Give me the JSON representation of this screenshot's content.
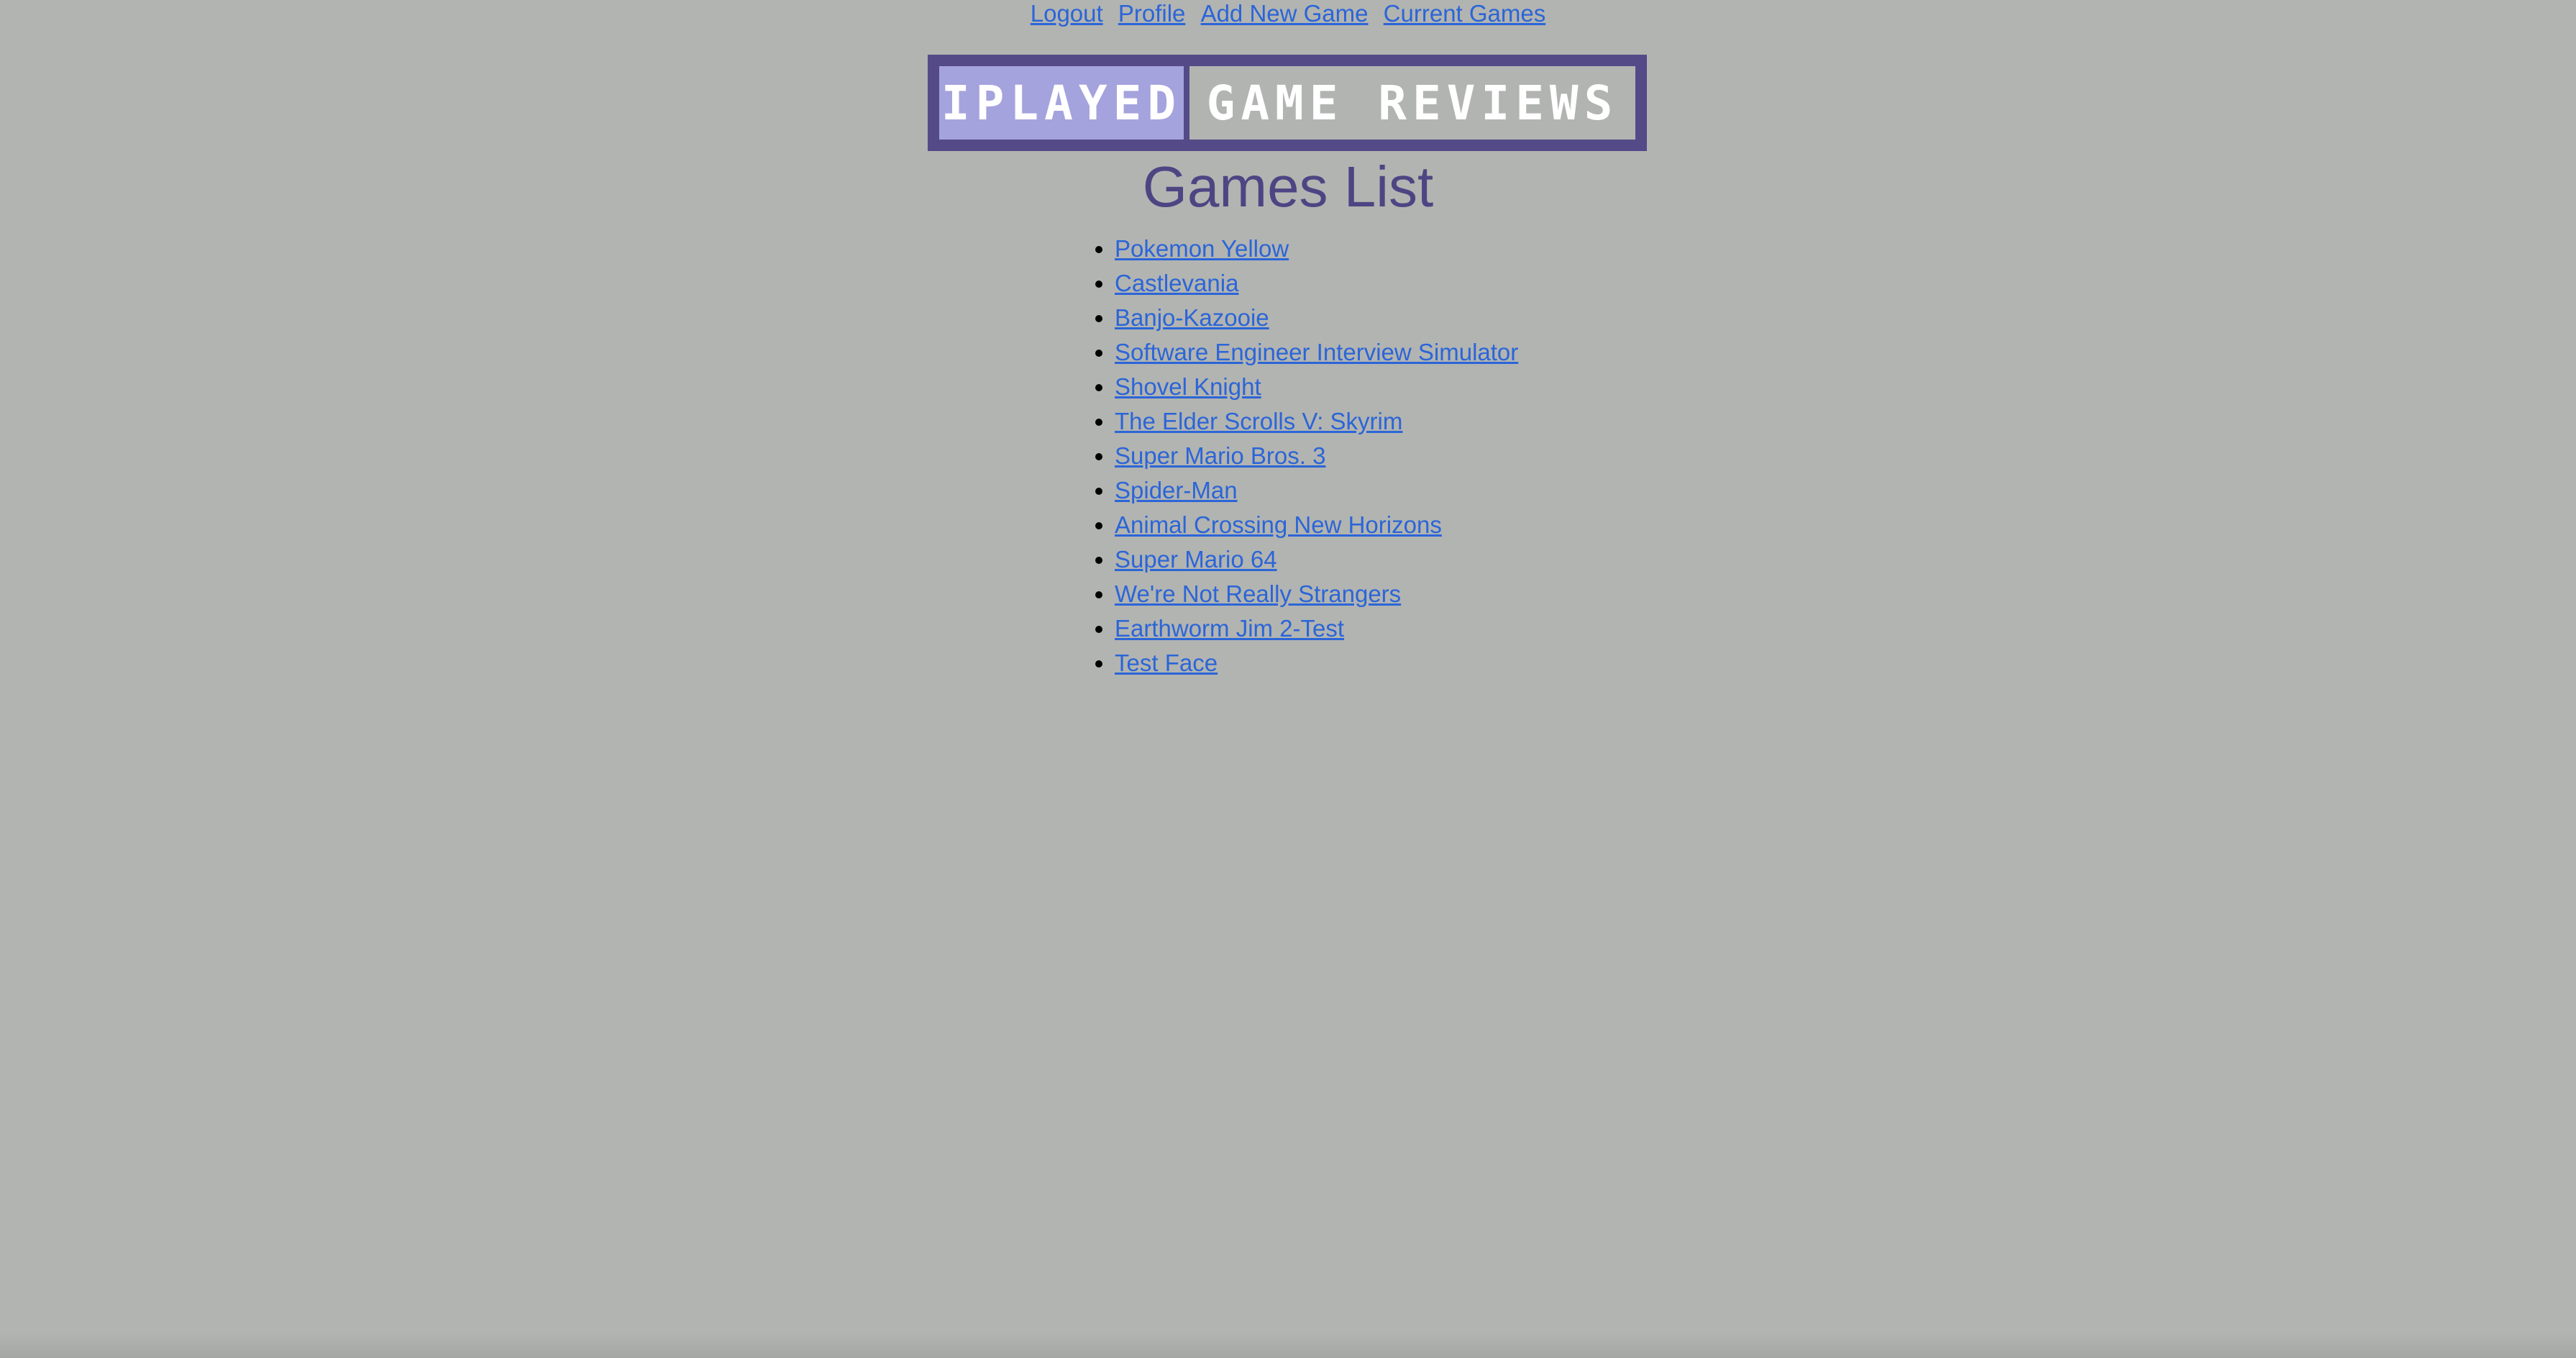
{
  "nav": {
    "items": [
      {
        "label": "Logout"
      },
      {
        "label": "Profile"
      },
      {
        "label": "Add New Game"
      },
      {
        "label": "Current Games"
      }
    ]
  },
  "logo": {
    "left": "iPLAYED",
    "right": "GAME REVIEWS"
  },
  "page": {
    "title": "Games List"
  },
  "games": [
    {
      "title": "Pokemon Yellow"
    },
    {
      "title": "Castlevania"
    },
    {
      "title": "Banjo-Kazooie"
    },
    {
      "title": "Software Engineer Interview Simulator"
    },
    {
      "title": "Shovel Knight"
    },
    {
      "title": "The Elder Scrolls V: Skyrim"
    },
    {
      "title": "Super Mario Bros. 3"
    },
    {
      "title": "Spider-Man"
    },
    {
      "title": "Animal Crossing New Horizons"
    },
    {
      "title": "Super Mario 64"
    },
    {
      "title": "We're Not Really Strangers"
    },
    {
      "title": "Earthworm Jim 2-Test"
    },
    {
      "title": "Test Face"
    }
  ],
  "colors": {
    "background": "#b2b4b1",
    "link": "#2b65d8",
    "title": "#4d4583",
    "logo_frame": "#544a87",
    "logo_left": "#a5a3dd"
  }
}
